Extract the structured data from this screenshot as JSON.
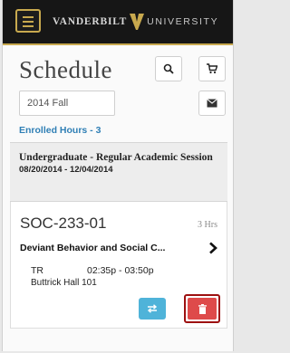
{
  "header": {
    "brand_left": "VANDERBILT",
    "brand_right": "UNIVERSITY",
    "brand_color": "#c8a94e",
    "menu_icon": "hamburger-menu-icon"
  },
  "page": {
    "title": "Schedule",
    "search_icon": "search-icon",
    "cart_icon": "cart-icon"
  },
  "term": {
    "selected": "2014 Fall",
    "mail_icon": "envelope-icon"
  },
  "enrolled": {
    "label": "Enrolled Hours - 3"
  },
  "session": {
    "title": "Undergraduate - Regular Academic Session",
    "dates": "08/20/2014 - 12/04/2014"
  },
  "course": {
    "code": "SOC-233-01",
    "hours": "3 Hrs",
    "name": "Deviant Behavior and Social C...",
    "days": "TR",
    "time": "02:35p - 03:50p",
    "location": "Buttrick Hall 101",
    "swap_icon": "swap-icon",
    "delete_icon": "trash-icon"
  },
  "colors": {
    "link": "#2f7fb5",
    "swap": "#4fb3d9",
    "delete": "#de4a4a"
  }
}
